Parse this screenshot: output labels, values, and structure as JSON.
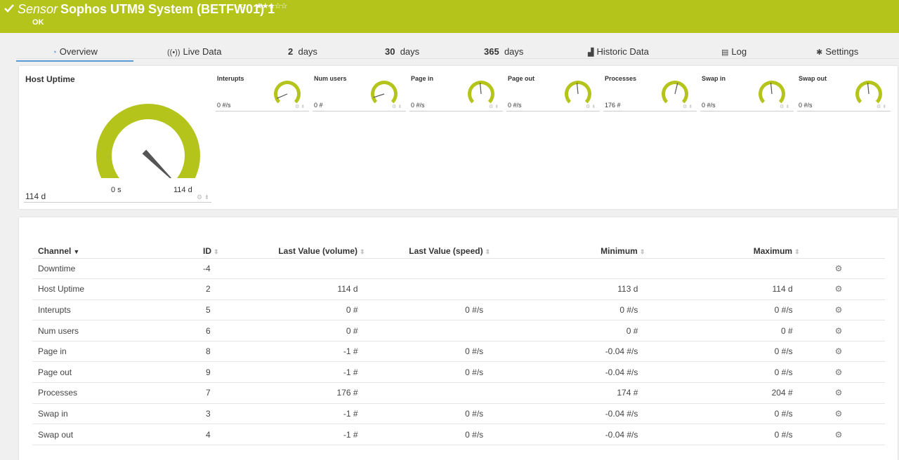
{
  "header": {
    "kind": "Sensor",
    "title": "Sophos UTM9 System (BETFW01) 1",
    "flag": "⚐",
    "stars": "★★★☆☆",
    "status": "OK",
    "color": "#b4c41b"
  },
  "tabs": [
    {
      "icon": "◔",
      "label": "Overview"
    },
    {
      "icon": "((•))",
      "label": "Live Data"
    },
    {
      "num": "2",
      "label": "days"
    },
    {
      "num": "30",
      "label": "days"
    },
    {
      "num": "365",
      "label": "days"
    },
    {
      "icon": "▟",
      "label": "Historic Data"
    },
    {
      "icon": "▤",
      "label": "Log"
    },
    {
      "icon": "✱",
      "label": "Settings"
    }
  ],
  "big_gauge": {
    "title": "Host Uptime",
    "value": "114 d",
    "min_label": "0 s",
    "max_label": "114 d",
    "level": 1.0
  },
  "gauges": [
    {
      "label": "Interupts",
      "value": "0 #/s",
      "level": 0.08
    },
    {
      "label": "Num users",
      "value": "0 #",
      "level": 0.1
    },
    {
      "label": "Page in",
      "value": "0 #/s",
      "level": 0.48
    },
    {
      "label": "Page out",
      "value": "0 #/s",
      "level": 0.48
    },
    {
      "label": "Processes",
      "value": "176 #",
      "level": 0.55
    },
    {
      "label": "Swap in",
      "value": "0 #/s",
      "level": 0.48
    },
    {
      "label": "Swap out",
      "value": "0 #/s",
      "level": 0.48
    }
  ],
  "table": {
    "headers": {
      "channel": "Channel",
      "id": "ID",
      "last_volume": "Last Value (volume)",
      "last_speed": "Last Value (speed)",
      "minimum": "Minimum",
      "maximum": "Maximum"
    },
    "rows": [
      {
        "channel": "Downtime",
        "id": "-4",
        "volume": "",
        "speed": "",
        "min": "",
        "max": ""
      },
      {
        "channel": "Host Uptime",
        "id": "2",
        "volume": "114 d",
        "speed": "",
        "min": "113 d",
        "max": "114 d"
      },
      {
        "channel": "Interupts",
        "id": "5",
        "volume": "0 #",
        "speed": "0 #/s",
        "min": "0 #/s",
        "max": "0 #/s"
      },
      {
        "channel": "Num users",
        "id": "6",
        "volume": "0 #",
        "speed": "",
        "min": "0 #",
        "max": "0 #"
      },
      {
        "channel": "Page in",
        "id": "8",
        "volume": "-1 #",
        "speed": "0 #/s",
        "min": "-0.04 #/s",
        "max": "0 #/s"
      },
      {
        "channel": "Page out",
        "id": "9",
        "volume": "-1 #",
        "speed": "0 #/s",
        "min": "-0.04 #/s",
        "max": "0 #/s"
      },
      {
        "channel": "Processes",
        "id": "7",
        "volume": "176 #",
        "speed": "",
        "min": "174 #",
        "max": "204 #"
      },
      {
        "channel": "Swap in",
        "id": "3",
        "volume": "-1 #",
        "speed": "0 #/s",
        "min": "-0.04 #/s",
        "max": "0 #/s"
      },
      {
        "channel": "Swap out",
        "id": "4",
        "volume": "-1 #",
        "speed": "0 #/s",
        "min": "-0.04 #/s",
        "max": "0 #/s"
      }
    ]
  }
}
